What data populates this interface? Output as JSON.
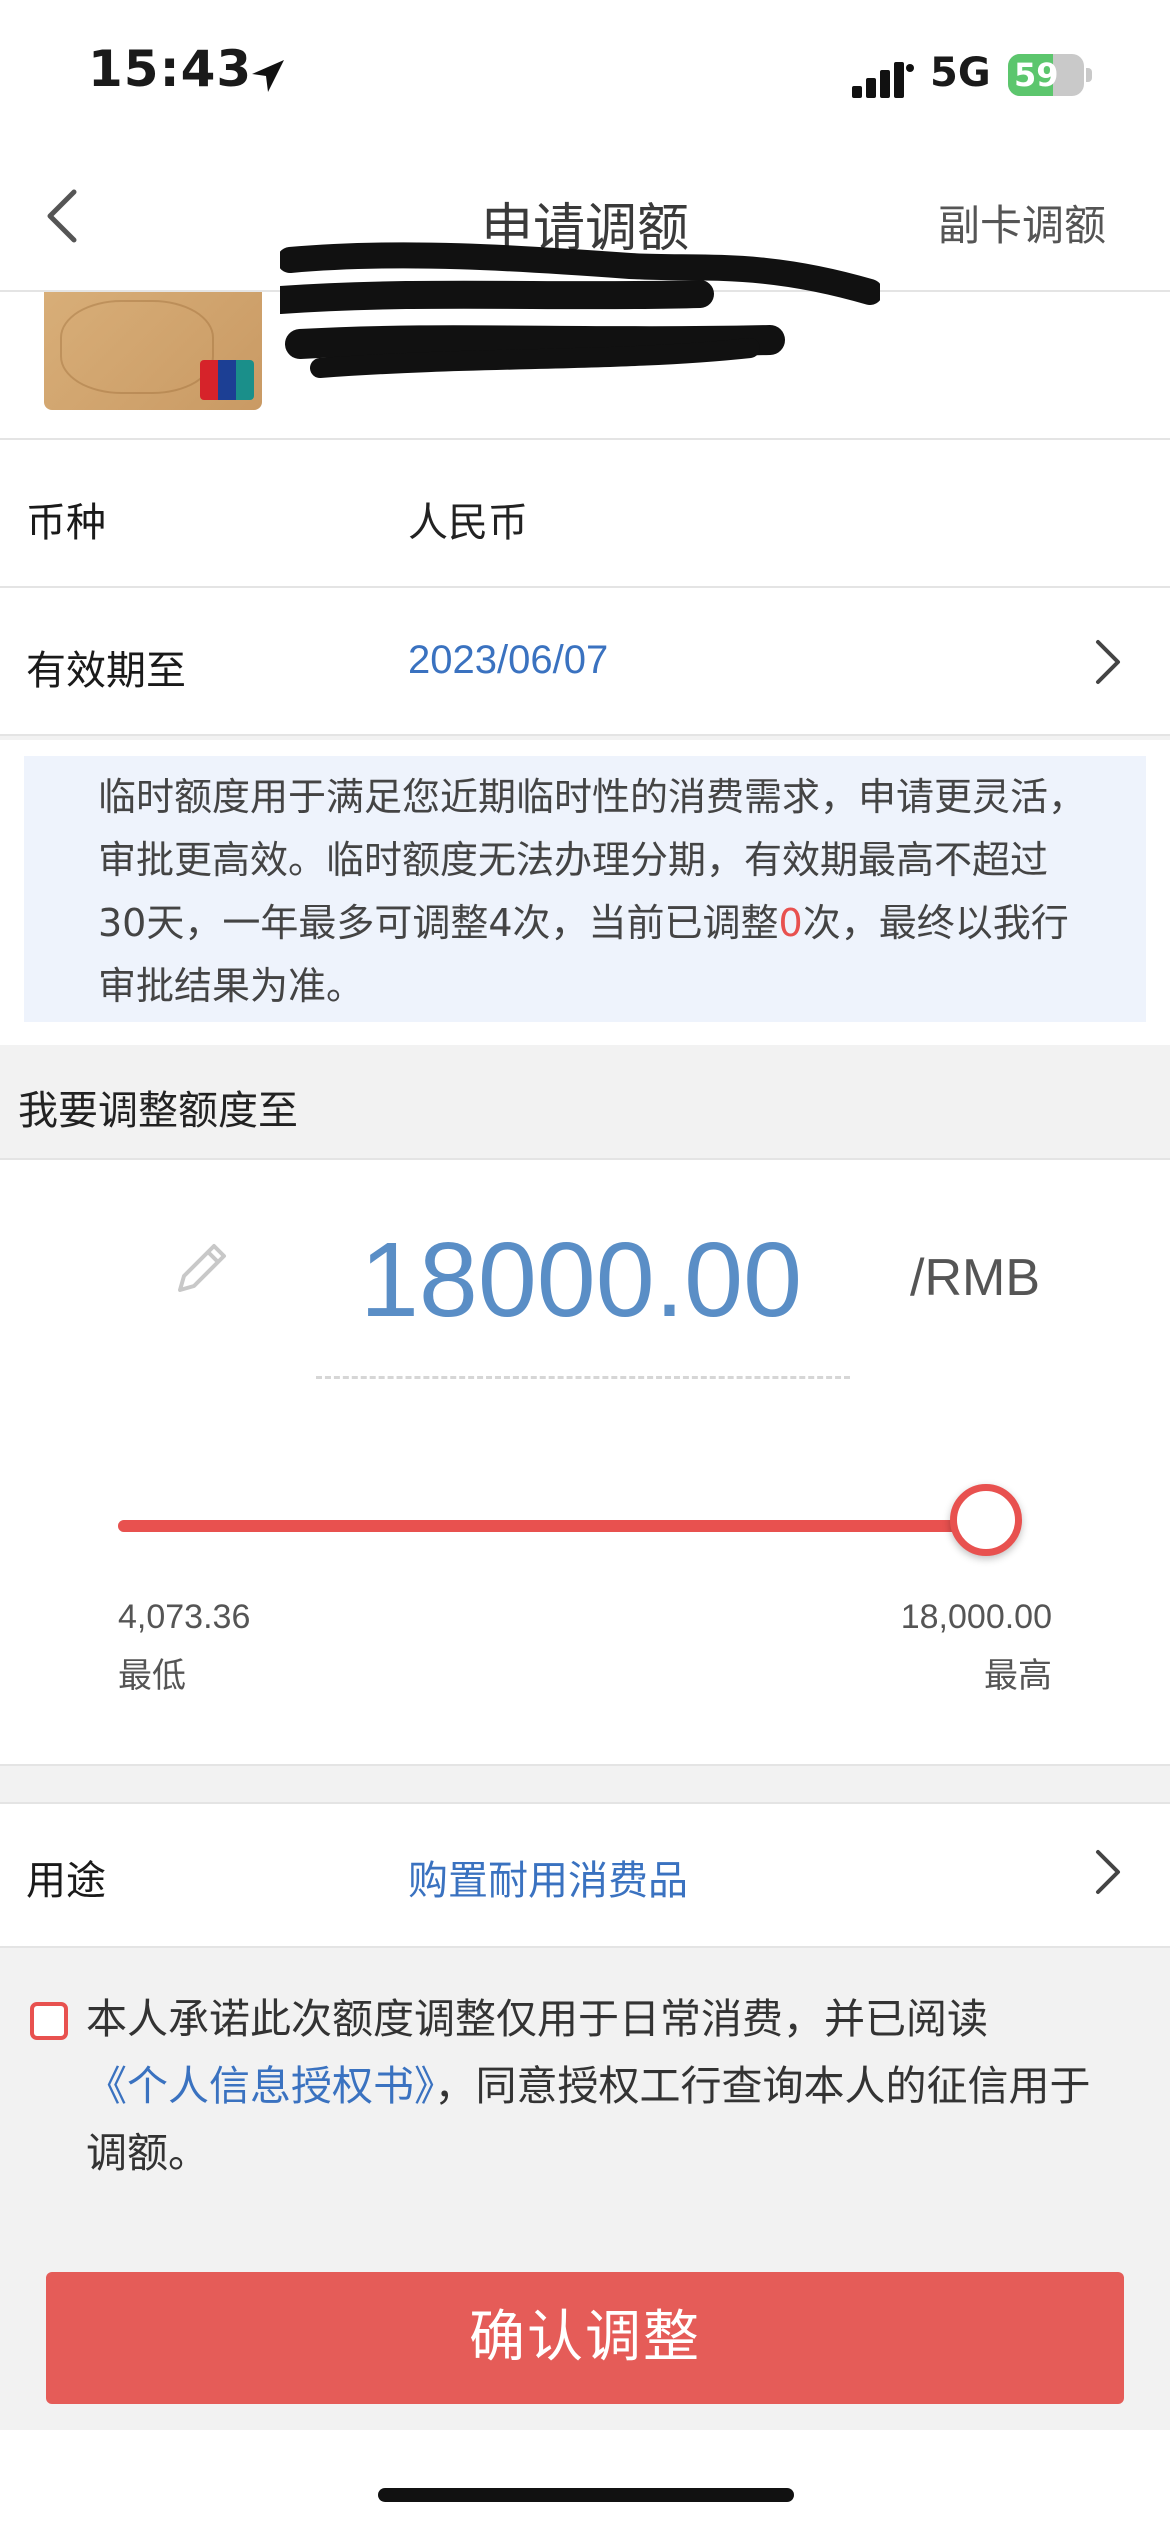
{
  "status_bar": {
    "time": "15:43",
    "network": "5G",
    "battery": "59"
  },
  "nav": {
    "title": "申请调额",
    "right_action": "副卡调额"
  },
  "rows": {
    "currency": {
      "label": "币种",
      "value": "人民币"
    },
    "expiry": {
      "label": "有效期至",
      "value": "2023/06/07"
    }
  },
  "notice": {
    "text_before": "临时额度用于满足您近期临时性的消费需求，申请更灵活，审批更高效。临时额度无法办理分期，有效期最高不超过 30天，一年最多可调整4次，当前已调整",
    "adjusted_count": "0",
    "text_after": "次，最终以我行审批结果为准。"
  },
  "section_title": "我要调整额度至",
  "amount": {
    "value": "18000.00",
    "unit": "/RMB"
  },
  "slider": {
    "min_value": "4,073.36",
    "min_label": "最低",
    "max_value": "18,000.00",
    "max_label": "最高",
    "level": 1.0
  },
  "purpose": {
    "label": "用途",
    "value": "购置耐用消费品"
  },
  "agreement": {
    "text_before": "本人承诺此次额度调整仅用于日常消费，并已阅读",
    "link": "《个人信息授权书》",
    "text_after": "，同意授权工行查询本人的征信用于调额。"
  },
  "confirm_button": "确认调整",
  "colors": {
    "accent": "#e8514f",
    "link": "#3a72c0",
    "amount": "#5a8ec6"
  }
}
